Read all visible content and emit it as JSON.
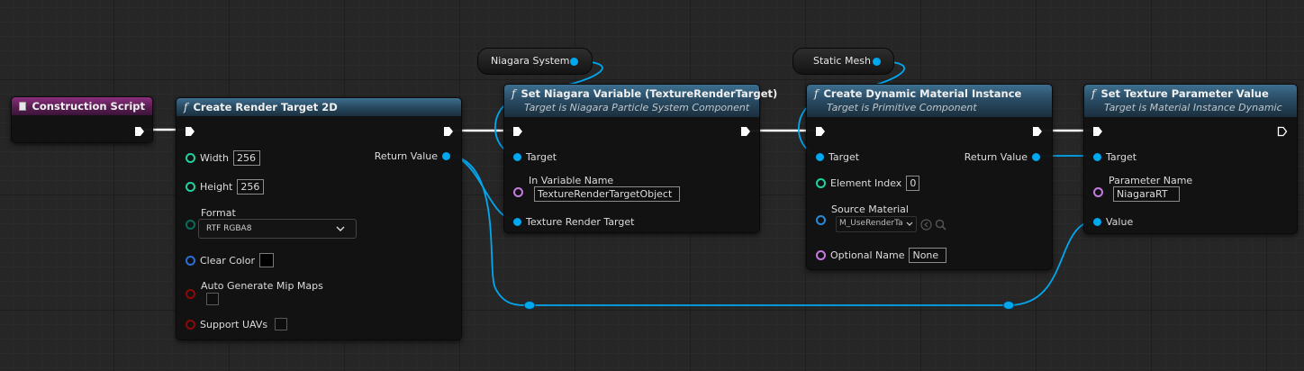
{
  "nodes": {
    "construction_script": {
      "title": "Construction Script"
    },
    "create_render_target": {
      "title": "Create Render Target 2D",
      "width_label": "Width",
      "width_value": "256",
      "height_label": "Height",
      "height_value": "256",
      "format_label": "Format",
      "format_value": "RTF RGBA8",
      "clear_color_label": "Clear Color",
      "auto_mips_label": "Auto Generate Mip Maps",
      "uavs_label": "Support UAVs",
      "return_label": "Return Value"
    },
    "niagara_system_var": {
      "label": "Niagara System"
    },
    "static_mesh_var": {
      "label": "Static Mesh"
    },
    "set_niagara_variable": {
      "title": "Set Niagara Variable (TextureRenderTarget)",
      "subtitle": "Target is Niagara Particle System Component",
      "target_label": "Target",
      "var_name_label": "In Variable Name",
      "var_name_value": "TextureRenderTargetObject",
      "texture_rt_label": "Texture Render Target"
    },
    "create_dmi": {
      "title": "Create Dynamic Material Instance",
      "subtitle": "Target is Primitive Component",
      "target_label": "Target",
      "return_label": "Return Value",
      "element_index_label": "Element Index",
      "element_index_value": "0",
      "source_material_label": "Source Material",
      "source_material_value": "M_UseRenderTa",
      "optional_name_label": "Optional Name",
      "optional_name_value": "None"
    },
    "set_texture_param": {
      "title": "Set Texture Parameter Value",
      "subtitle": "Target is Material Instance Dynamic",
      "target_label": "Target",
      "param_name_label": "Parameter Name",
      "param_name_value": "NiagaraRT",
      "value_label": "Value"
    }
  },
  "colors": {
    "background": "#262626",
    "function_header": "#3d6f8f",
    "event_header": "#8b2f7e",
    "exec_wire": "#ffffff",
    "object_pin": "#00a8f0",
    "int_pin": "#1fd3a0",
    "name_pin": "#c67be0",
    "struct_pin": "#2a6ed6",
    "bool_pin": "#8c0a0a"
  },
  "icons": {
    "function": "function-f-icon",
    "event": "event-icon",
    "exec": "exec-arrow-icon",
    "dropdown": "chevron-down-icon",
    "browse": "browse-arrow-icon",
    "find": "search-icon"
  }
}
